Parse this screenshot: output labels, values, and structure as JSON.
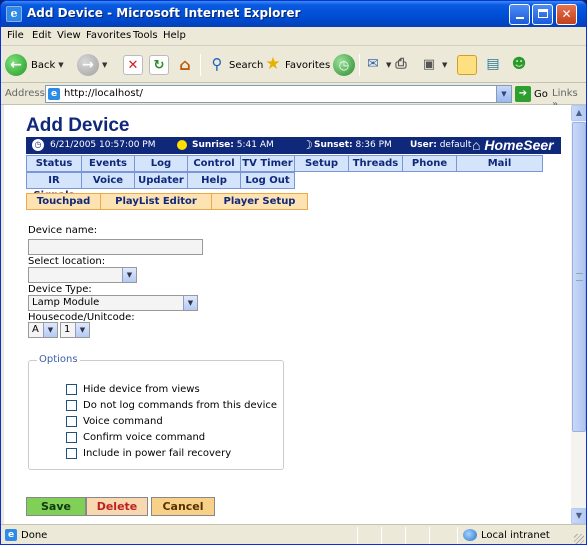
{
  "window": {
    "title": "Add Device - Microsoft Internet Explorer",
    "title_icon": "ie-icon"
  },
  "menubar": {
    "items": [
      "File",
      "Edit",
      "View",
      "Favorites",
      "Tools",
      "Help"
    ]
  },
  "toolbar": {
    "back_label": "Back",
    "search_label": "Search",
    "favorites_label": "Favorites"
  },
  "addressbar": {
    "label": "Address",
    "url": "http://localhost/",
    "go_label": "Go",
    "links_label": "Links"
  },
  "page": {
    "title": "Add Device",
    "info": {
      "datetime": "6/21/2005 10:57:00 PM",
      "sunrise_label": "Sunrise:",
      "sunrise_value": "5:41 AM",
      "sunset_label": "Sunset:",
      "sunset_value": "8:36 PM",
      "user_label": "User:",
      "user_value": "default",
      "logo": "HomeSeer"
    },
    "nav_row1": [
      "Status",
      "Events",
      "Log",
      "Control",
      "TV Timer",
      "Setup",
      "Threads",
      "Phone",
      "Mail"
    ],
    "nav_row2": [
      "IR Signals",
      "Voice",
      "Updater",
      "Help",
      "Log Out"
    ],
    "nav_row3": [
      "Touchpad",
      "PlayList Editor",
      "Player Setup"
    ],
    "form": {
      "device_name_label": "Device name:",
      "device_name_value": "",
      "location_label": "Select location:",
      "location_value": "",
      "device_type_label": "Device Type:",
      "device_type_value": "Lamp Module",
      "housecode_label": "Housecode/Unitcode:",
      "housecode_value": "A",
      "unitcode_value": "1",
      "options_legend": "Options",
      "options": [
        "Hide device from views",
        "Do not log commands from this device",
        "Voice command",
        "Confirm voice command",
        "Include in power fail recovery"
      ]
    },
    "actions": {
      "save": "Save",
      "delete": "Delete",
      "cancel": "Cancel"
    }
  },
  "statusbar": {
    "status": "Done",
    "zone": "Local intranet"
  },
  "colors": {
    "titlebar": "#0050d8",
    "brand_navy": "#10287a",
    "nav_blue": "#d4e4fb",
    "nav_orange": "#fde2b2",
    "save_green": "#80d058"
  }
}
